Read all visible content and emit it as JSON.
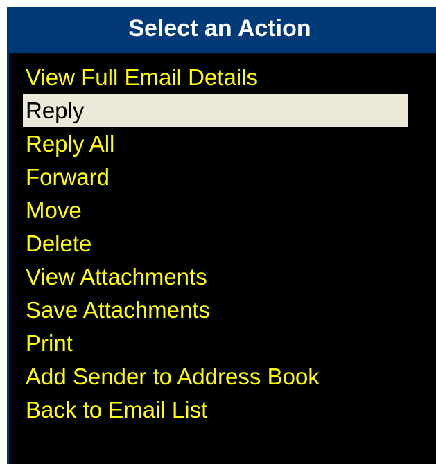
{
  "dialog": {
    "title": "Select an Action",
    "selected_index": 1,
    "items": [
      {
        "label": "View Full Email Details"
      },
      {
        "label": "Reply"
      },
      {
        "label": "Reply All"
      },
      {
        "label": "Forward"
      },
      {
        "label": "Move"
      },
      {
        "label": "Delete"
      },
      {
        "label": "View Attachments"
      },
      {
        "label": "Save Attachments"
      },
      {
        "label": "Print"
      },
      {
        "label": "Add Sender to Address Book"
      },
      {
        "label": "Back to Email List"
      }
    ]
  },
  "colors": {
    "title_bar": "#003a78",
    "title_text": "#ffffff",
    "background": "#000000",
    "item_text": "#ffff00",
    "selected_background": "#ece9d8",
    "selected_text": "#000000"
  }
}
